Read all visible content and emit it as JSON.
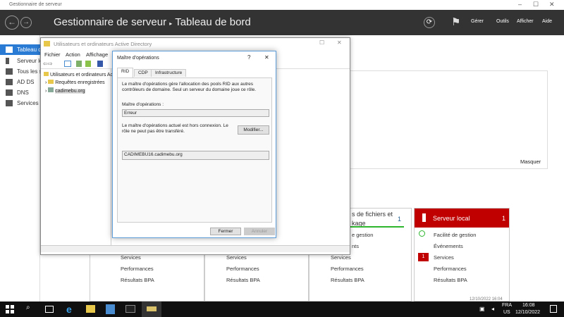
{
  "window": {
    "title": "Gestionnaire de serveur",
    "min": "–",
    "max": "☐",
    "close": "✕"
  },
  "header": {
    "back": "←",
    "forward": "→",
    "breadcrumb_root": "Gestionnaire de serveur",
    "separator": "▸",
    "breadcrumb_page": "Tableau de bord",
    "refresh": "⟳",
    "flag": "⚑",
    "menus": [
      "Gérer",
      "Outils",
      "Afficher",
      "Aide"
    ]
  },
  "sidebar": {
    "items": [
      {
        "label": "Tableau de bord",
        "active": true
      },
      {
        "label": "Serveur local"
      },
      {
        "label": "Tous les serveurs"
      },
      {
        "label": "AD DS"
      },
      {
        "label": "DNS"
      },
      {
        "label": "Services de fichiers et de stockage"
      }
    ]
  },
  "dashboard": {
    "hide": "Masquer",
    "cards": [
      {
        "rows": [
          "Services",
          "Performances",
          "Résultats BPA"
        ]
      },
      {
        "rows": [
          "Services",
          "Performances",
          "Résultats BPA"
        ]
      },
      {
        "title": "Services de fichiers et de stockage",
        "title_visible": "s de fichiers et",
        "title_visible2": "kage",
        "count": "1",
        "rows_partial": [
          "e gestion",
          "nts"
        ],
        "rows": [
          "Services",
          "Performances",
          "Résultats BPA"
        ]
      },
      {
        "title": "Serveur local",
        "count": "1",
        "rows": [
          "Facilité de gestion",
          "Événements",
          "Services",
          "Performances",
          "Résultats BPA"
        ],
        "services_badge": "1",
        "timestamp": "12/10/2022 16:04"
      }
    ],
    "accent_red": "#c00000",
    "accent_green": "#2db52d"
  },
  "ad_window": {
    "title": "Utilisateurs et ordinateurs Active Directory",
    "menu": [
      "Fichier",
      "Action",
      "Affichage"
    ],
    "tree": {
      "root": "Utilisateurs et ordinateurs Ac",
      "items": [
        "Requêtes enregistrées",
        "cadimebu.org"
      ]
    }
  },
  "dialog": {
    "title": "Maître d'opérations",
    "help": "?",
    "close": "✕",
    "tabs": [
      "RID",
      "CDP",
      "Infrastructure"
    ],
    "description": "Le maître d'opérations gère l'allocation des pools RID aux autres contrôleurs de domaine. Seul un serveur du domaine joue ce rôle.",
    "master_label": "Maître d'opérations :",
    "master_value": "Erreur",
    "offline_text": "Le maître d'opérations actuel est hors connexion. Le rôle ne peut pas être transféré.",
    "modify": "Modifier...",
    "server_value": "CADIMEBU16.cadimebu.org",
    "close_btn": "Fermer",
    "cancel_btn": "Annuler"
  },
  "taskbar": {
    "lang": "FRA",
    "layout": "US",
    "time": "16:08",
    "date": "12/10/2022"
  }
}
